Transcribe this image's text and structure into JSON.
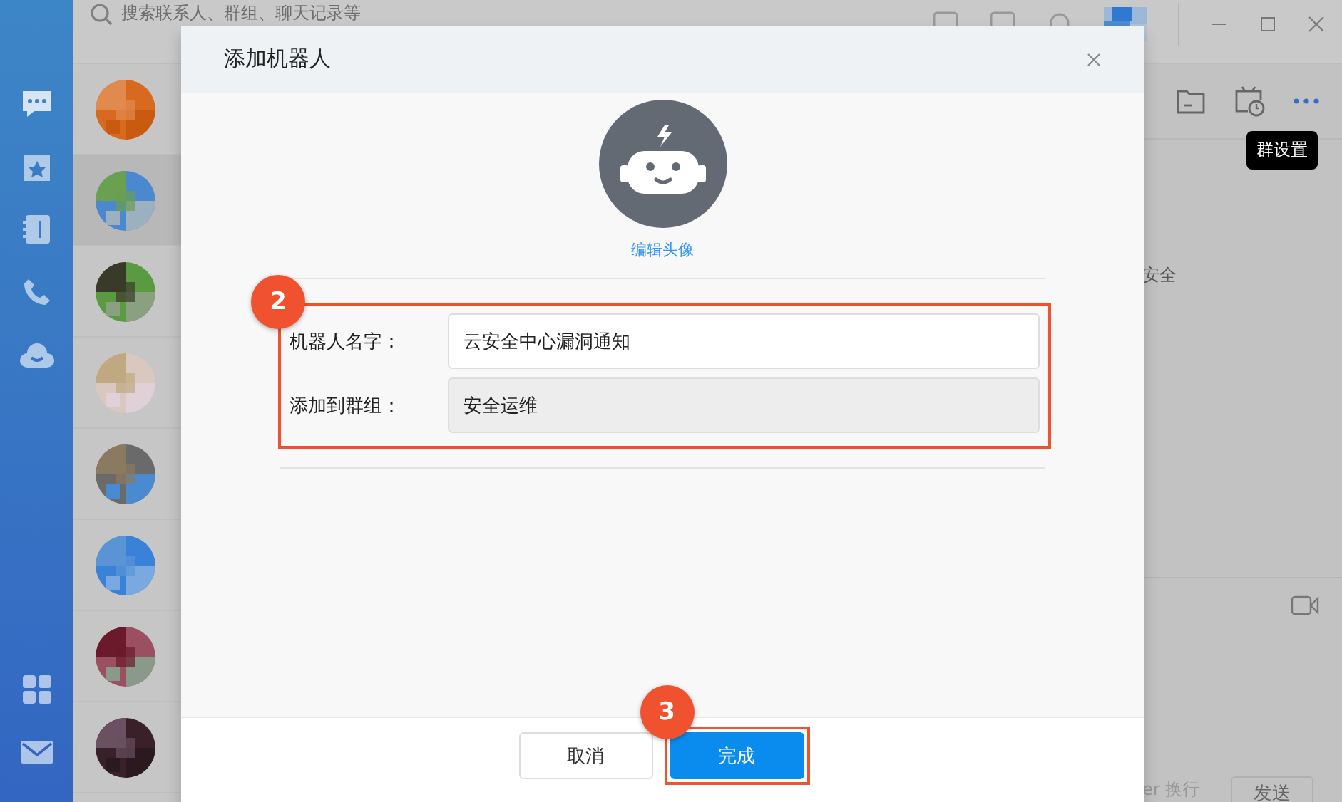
{
  "search": {
    "placeholder": "搜索联系人、群组、聊天记录等"
  },
  "nav": [
    {
      "kind": "chat",
      "selected": true
    },
    {
      "kind": "calendar",
      "selected": false
    },
    {
      "kind": "contacts",
      "selected": false
    },
    {
      "kind": "phone",
      "selected": false
    },
    {
      "kind": "cloud",
      "selected": false
    },
    {
      "kind": "apps",
      "selected": false
    },
    {
      "kind": "mail",
      "selected": false
    }
  ],
  "contacts": [
    {
      "selected": false
    },
    {
      "selected": true
    },
    {
      "selected": false
    },
    {
      "selected": false
    },
    {
      "selected": false
    },
    {
      "selected": false
    },
    {
      "selected": false
    },
    {
      "selected": false
    }
  ],
  "tooltip": "群设置",
  "chat": {
    "message_fragment": "安全",
    "input_hint": "er 换行",
    "send_button": "发送"
  },
  "dialog": {
    "title": "添加机器人",
    "edit_avatar_link": "编辑头像",
    "fields": [
      {
        "label": "机器人名字：",
        "value": "云安全中心漏洞通知",
        "disabled": false
      },
      {
        "label": "添加到群组：",
        "value": "安全运维",
        "disabled": true
      }
    ],
    "buttons": [
      {
        "label": "取消",
        "kind": "secondary"
      },
      {
        "label": "完成",
        "kind": "primary"
      }
    ]
  },
  "callouts": [
    "2",
    "3"
  ]
}
